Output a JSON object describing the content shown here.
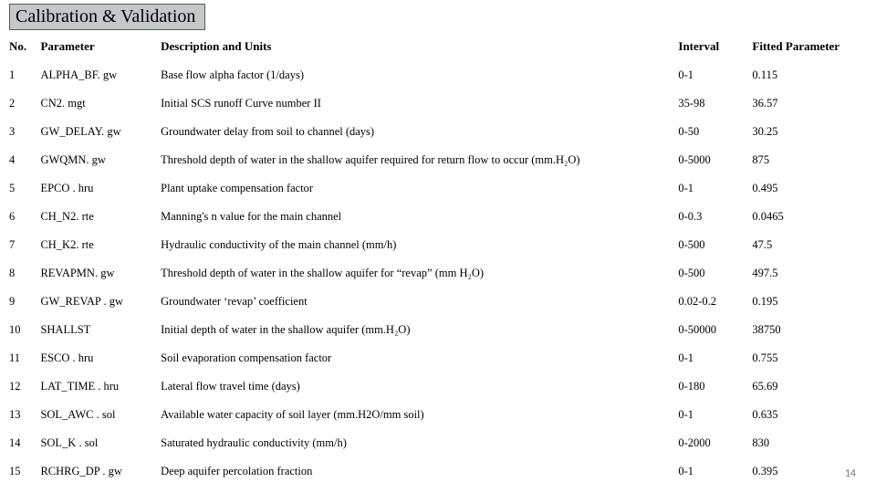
{
  "title": "Calibration & Validation",
  "page_number": "14",
  "headers": {
    "no": "No.",
    "parameter": "Parameter",
    "description": "Description and Units",
    "interval": "Interval",
    "fitted": "Fitted Parameter"
  },
  "rows": [
    {
      "no": "1",
      "param": "ALPHA_BF. gw",
      "desc": "Base flow alpha factor (1/days)",
      "interval": "0-1",
      "fitted": "0.115"
    },
    {
      "no": "2",
      "param": "CN2. mgt",
      "desc": "Initial SCS runoff Curve number II",
      "interval": "35-98",
      "fitted": "36.57"
    },
    {
      "no": "3",
      "param": "GW_DELAY. gw",
      "desc": "Groundwater delay from soil to channel (days)",
      "interval": "0-50",
      "fitted": "30.25"
    },
    {
      "no": "4",
      "param": "GWQMN. gw",
      "desc": "Threshold depth of water in the shallow aquifer required for return flow to occur (mm.H₂O)",
      "interval": "0-5000",
      "fitted": "875"
    },
    {
      "no": "5",
      "param": "EPCO . hru",
      "desc": "Plant uptake compensation factor",
      "interval": "0-1",
      "fitted": "0.495"
    },
    {
      "no": "6",
      "param": "CH_N2. rte",
      "desc": "Manning's n value for the main channel",
      "interval": "0-0.3",
      "fitted": "0.0465"
    },
    {
      "no": "7",
      "param": "CH_K2. rte",
      "desc": "Hydraulic conductivity of the main channel (mm/h)",
      "interval": "0-500",
      "fitted": "47.5"
    },
    {
      "no": "8",
      "param": "REVAPMN. gw",
      "desc": "Threshold depth of water in the shallow aquifer for “revap” (mm H₂O)",
      "interval": "0-500",
      "fitted": "497.5"
    },
    {
      "no": "9",
      "param": "GW_REVAP . gw",
      "desc": "Groundwater ‘revap’ coefficient",
      "interval": "0.02-0.2",
      "fitted": "0.195"
    },
    {
      "no": "10",
      "param": "SHALLST",
      "desc": "Initial depth of water in the shallow aquifer (mm.H₂O)",
      "interval": "0-50000",
      "fitted": "38750"
    },
    {
      "no": "11",
      "param": "ESCO . hru",
      "desc": "Soil evaporation compensation factor",
      "interval": "0-1",
      "fitted": "0.755"
    },
    {
      "no": "12",
      "param": "LAT_TIME . hru",
      "desc": "Lateral flow travel time (days)",
      "interval": "0-180",
      "fitted": "65.69"
    },
    {
      "no": "13",
      "param": "SOL_AWC . sol",
      "desc": "Available water capacity of soil layer (mm.H2O/mm soil)",
      "interval": "0-1",
      "fitted": "0.635"
    },
    {
      "no": "14",
      "param": "SOL_K . sol",
      "desc": "Saturated hydraulic conductivity (mm/h)",
      "interval": "0-2000",
      "fitted": "830"
    },
    {
      "no": "15",
      "param": "RCHRG_DP . gw",
      "desc": "Deep aquifer percolation fraction",
      "interval": "0-1",
      "fitted": "0.395"
    }
  ]
}
